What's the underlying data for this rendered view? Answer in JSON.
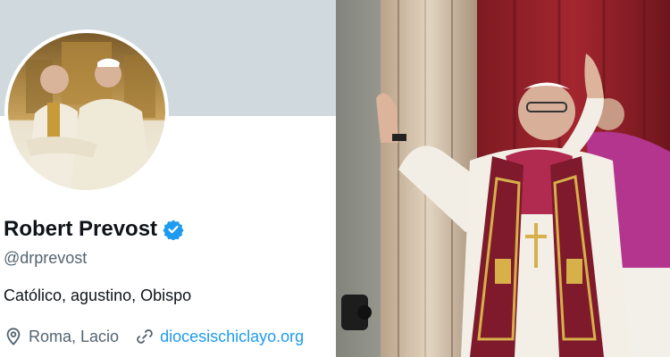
{
  "profile": {
    "name": "Robert Prevost",
    "handle": "@drprevost",
    "bio": "Católico, agustino, Obispo",
    "location": "Roma, Lacio",
    "website": "diocesischiclayo.org",
    "verified": true
  },
  "icons": {
    "verified": "verified-badge-icon",
    "location": "map-pin-icon",
    "link": "link-icon"
  },
  "colors": {
    "banner": "#cfd9de",
    "link": "#1d9bf0",
    "verified": "#1d9bf0",
    "secondary_text": "#536471"
  }
}
